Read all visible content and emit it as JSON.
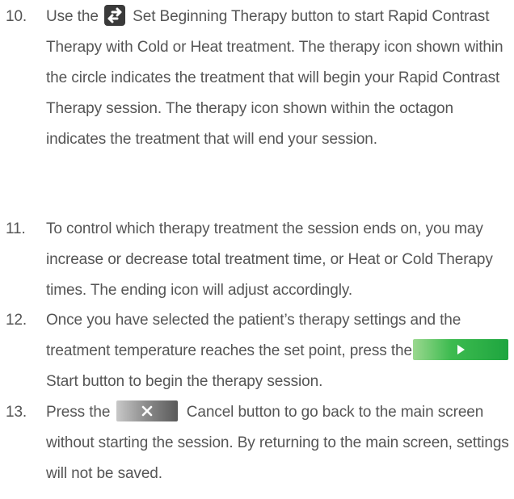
{
  "items": [
    {
      "number": "10.",
      "pre_icon": "Use the",
      "icon": "set-beginning-therapy-icon",
      "post_icon": "Set Beginning Therapy button to start Rapid Contrast Therapy with Cold or Heat treatment. The therapy icon shown within the circle indicates the treatment that will begin your Rapid Contrast Therapy session. The therapy icon shown within the octagon indicates the treatment that will end your session."
    },
    {
      "number": "11.",
      "text": "To control which therapy treatment the session ends on, you may increase or decrease total treatment time, or Heat or Cold Therapy times. The ending icon will adjust accordingly."
    },
    {
      "number": "12.",
      "text_before": "Once you have selected the patient’s therapy settings and the treatment temperature reaches the set point, press the",
      "icon": "start-play-icon",
      "post_icon": "Start button to begin the therapy session."
    },
    {
      "number": "13.",
      "pre_icon": "Press the",
      "icon": "cancel-x-icon",
      "post_icon": "Cancel button to go back to the main screen without starting the session. By returning to the main screen, settings will not be saved."
    }
  ],
  "colors": {
    "text": "#555555",
    "start_button_green": "#1ea53f",
    "cancel_button_gray": "#6e6e6e",
    "beginning_icon_bg": "#3a3a3a"
  }
}
